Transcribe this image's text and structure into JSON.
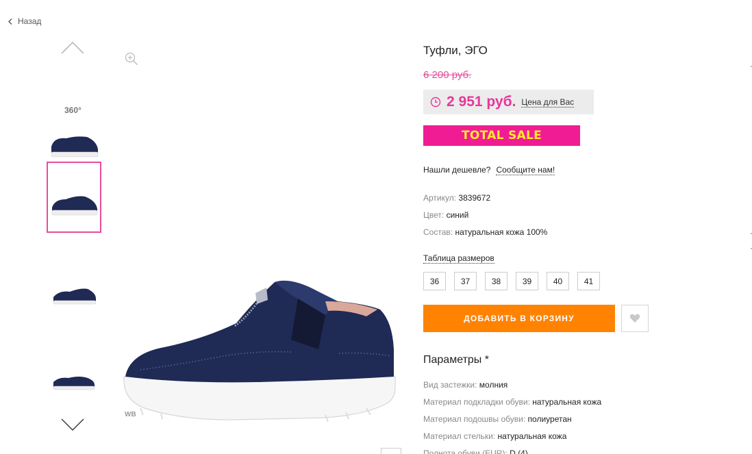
{
  "nav": {
    "back_label": "Назад"
  },
  "gallery": {
    "badge_360": "360°",
    "watermark": "WB"
  },
  "product": {
    "title": "Туфли, ЭГО",
    "old_price": "6 200 руб.",
    "price": "2 951 руб.",
    "price_note": "Цена для Вас",
    "sale_banner": "TOTAL SALE",
    "cheaper_question": "Нашли дешевле?",
    "cheaper_link": "Сообщите нам!",
    "attributes": [
      {
        "label": "Артикул:",
        "value": "3839672"
      },
      {
        "label": "Цвет:",
        "value": "синий"
      },
      {
        "label": "Состав:",
        "value": "натуральная кожа 100%"
      }
    ],
    "size_table_label": "Таблица размеров",
    "sizes": [
      "36",
      "37",
      "38",
      "39",
      "40",
      "41"
    ],
    "add_to_cart_label": "ДОБАВИТЬ В КОРЗИНУ",
    "params_title": "Параметры *",
    "params": [
      {
        "label": "Вид застежки:",
        "value": "молния"
      },
      {
        "label": "Материал подкладки обуви:",
        "value": "натуральная кожа"
      },
      {
        "label": "Материал подошвы обуви:",
        "value": "полиуретан"
      },
      {
        "label": "Материал стельки:",
        "value": "натуральная кожа"
      },
      {
        "label": "Полнота обуви (EUR):",
        "value": "D (4)"
      }
    ]
  },
  "colors": {
    "price_pink": "#e8369a",
    "sale_bg": "#f01c94",
    "sale_text": "#ffe92b",
    "cart_orange": "#ff8200",
    "thumb_active_border": "#e84c9a",
    "shoe_navy": "#1f2a55"
  },
  "icons": {
    "back": "chevron-left-icon",
    "zoom": "zoom-in-icon",
    "fav": "heart-icon",
    "clock": "clock-icon",
    "up": "chevron-up-icon",
    "down": "chevron-down-icon"
  }
}
